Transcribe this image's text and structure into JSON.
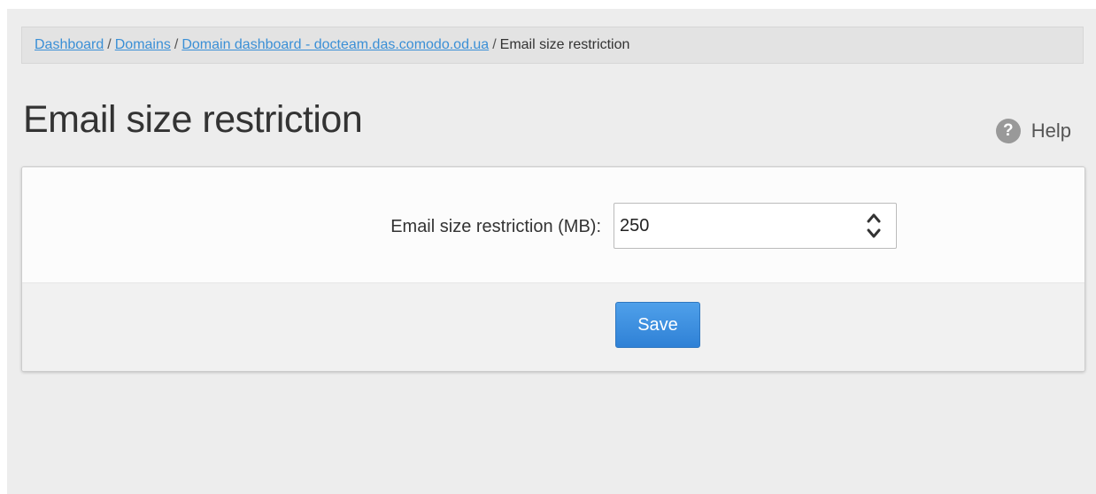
{
  "breadcrumb": {
    "items": [
      {
        "label": "Dashboard",
        "link": true
      },
      {
        "label": "Domains",
        "link": true
      },
      {
        "label": "Domain dashboard - docteam.das.comodo.od.ua",
        "link": true
      },
      {
        "label": "Email size restriction",
        "link": false
      }
    ],
    "separator": "/"
  },
  "page": {
    "title": "Email size restriction",
    "help_label": "Help",
    "help_icon": "question-circle-icon"
  },
  "form": {
    "size_label": "Email size restriction (MB):",
    "size_value": "250",
    "spinner_icon": "up-down-spinner-icon",
    "save_label": "Save"
  },
  "colors": {
    "link": "#3a8fd6",
    "button": "#2f81d6"
  }
}
